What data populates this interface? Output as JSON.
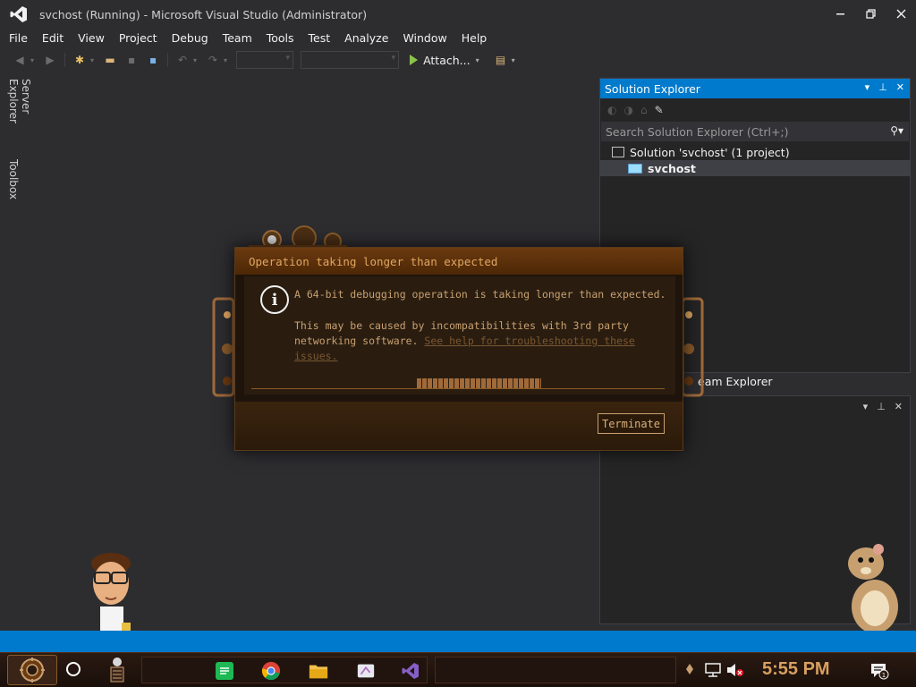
{
  "window": {
    "title": "svchost (Running) - Microsoft Visual Studio  (Administrator)",
    "controls": {
      "minimize": "✕",
      "maximize": "✕",
      "close": "✕"
    }
  },
  "menu": [
    "File",
    "Edit",
    "View",
    "Project",
    "Debug",
    "Team",
    "Tools",
    "Test",
    "Analyze",
    "Window",
    "Help"
  ],
  "toolbar": {
    "attach_label": "Attach..."
  },
  "left_tabs": {
    "server_explorer": "Server Explorer",
    "toolbox": "Toolbox"
  },
  "solution_explorer": {
    "title": "Solution Explorer",
    "search_placeholder": "Search Solution Explorer (Ctrl+;)",
    "solution_label": "Solution 'svchost' (1 project)",
    "project_label": "svchost"
  },
  "team_explorer": {
    "title": "eam Explorer"
  },
  "dialog": {
    "title": "Operation taking longer than expected",
    "message_primary": "A 64-bit debugging operation is taking longer than expected.",
    "message_secondary": "This may be caused by incompatibilities with 3rd party networking software.",
    "help_link": "See help for troubleshooting these issues.",
    "terminate_label": "Terminate",
    "progress": {
      "start": 0.4,
      "end": 0.7
    }
  },
  "taskbar": {
    "clock": "5:55 PM",
    "icons": [
      "start-gear-icon",
      "cortana-icon",
      "spotify-icon",
      "chrome-icon",
      "file-explorer-icon",
      "paint-icon",
      "visual-studio-icon",
      "network-icon",
      "volume-muted-icon",
      "notifications-icon"
    ],
    "notification_count": "1"
  },
  "colors": {
    "accent": "#007acc",
    "background": "#2d2d30",
    "dialog_text": "#c8a070",
    "clock": "#d8a060"
  }
}
